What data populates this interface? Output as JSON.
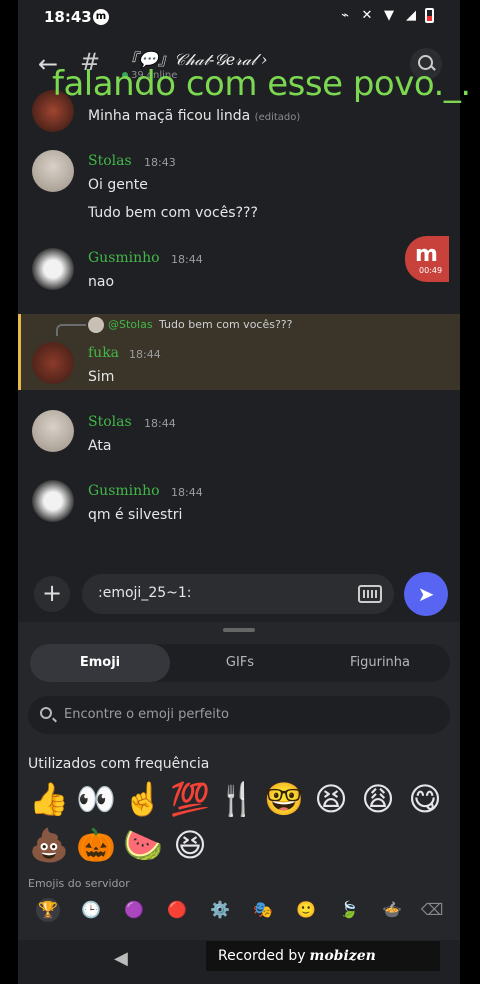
{
  "status": {
    "time": "18:43",
    "notif_glyph": "m"
  },
  "topbar": {
    "channel": "『💬』𝒞𝒽𝒶𝓉-𝒢𝑒𝓇𝒶𝓁 ›",
    "online": "39 online"
  },
  "overlay_caption": "falando com esse povo._.",
  "messages": [
    {
      "text": "Minha maçã ficou linda",
      "edited": "(editado)"
    },
    {
      "user": "Stolas",
      "time": "18:43",
      "lines": [
        "Oi gente",
        "Tudo bem com vocês???"
      ]
    },
    {
      "user": "Gusminho",
      "time": "18:44",
      "lines": [
        "nao"
      ]
    },
    {
      "reply_user": "@Stolas",
      "reply_text": "Tudo bem com vocês???",
      "user": "fuka",
      "time": "18:44",
      "lines": [
        "Sim"
      ]
    },
    {
      "user": "Stolas",
      "time": "18:44",
      "lines": [
        "Ata"
      ]
    },
    {
      "user": "Gusminho",
      "time": "18:44",
      "lines": [
        "qm é silvestri"
      ]
    }
  ],
  "mobizen_bubble": {
    "letter": "m",
    "time": "00:49"
  },
  "composer": {
    "value": ":emoji_25~1:"
  },
  "drawer": {
    "tabs": [
      "Emoji",
      "GIFs",
      "Figurinha"
    ],
    "search_placeholder": "Encontre o emoji perfeito",
    "section_title": "Utilizados com frequência",
    "frequent": [
      "👍",
      "👀",
      "☝️",
      "💯",
      "🍴",
      "🤓",
      "😫",
      "😩",
      "😋",
      "💩",
      "🎃",
      "🍉",
      "😆"
    ],
    "section2_partial": "Emojis do servidor",
    "categories": [
      "🏆",
      "🕒",
      "🟣",
      "🔴",
      "⚙️",
      "🎭",
      "🙂",
      "🍃",
      "🍲",
      "⌫"
    ]
  },
  "recorder": {
    "label": "Recorded by",
    "brand": "mobizen"
  }
}
